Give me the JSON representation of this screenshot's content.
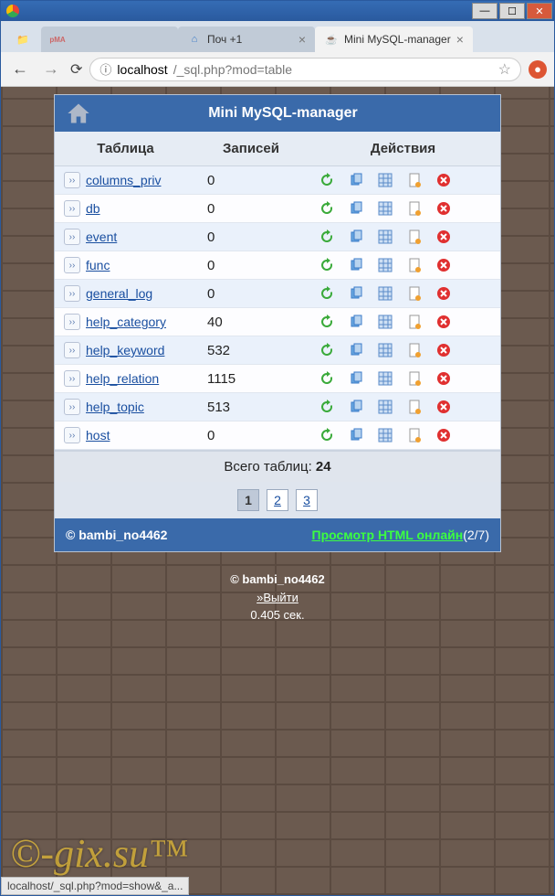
{
  "window": {
    "title": ""
  },
  "tabs": [
    {
      "label": "",
      "favicon": "pma"
    },
    {
      "label": "Поч +1",
      "favicon": "blue"
    },
    {
      "label": "Mini MySQL-manager",
      "favicon": "cup",
      "active": true
    }
  ],
  "url": {
    "host": "localhost",
    "path": "/_sql.php?mod=table"
  },
  "panel": {
    "title": "Mini MySQL-manager",
    "columns": {
      "table": "Таблица",
      "records": "Записей",
      "actions": "Действия"
    },
    "rows": [
      {
        "name": "columns_priv",
        "records": "0"
      },
      {
        "name": "db",
        "records": "0"
      },
      {
        "name": "event",
        "records": "0"
      },
      {
        "name": "func",
        "records": "0"
      },
      {
        "name": "general_log",
        "records": "0"
      },
      {
        "name": "help_category",
        "records": "40"
      },
      {
        "name": "help_keyword",
        "records": "532"
      },
      {
        "name": "help_relation",
        "records": "1115"
      },
      {
        "name": "help_topic",
        "records": "513"
      },
      {
        "name": "host",
        "records": "0"
      }
    ],
    "totals": {
      "label": "Всего таблиц: ",
      "value": "24"
    },
    "pages": [
      "1",
      "2",
      "3"
    ],
    "current_page": "1",
    "footer": {
      "copyright": "© bambi_no4462",
      "link_text": "Просмотр HTML онлайн",
      "counter": "(2/7)"
    }
  },
  "below": {
    "copyright": "© bambi_no4462",
    "logout": "»Выйти",
    "time": "0.405 сек."
  },
  "watermark": "©-gix.su™",
  "status_bar": "localhost/_sql.php?mod=show&_a..."
}
